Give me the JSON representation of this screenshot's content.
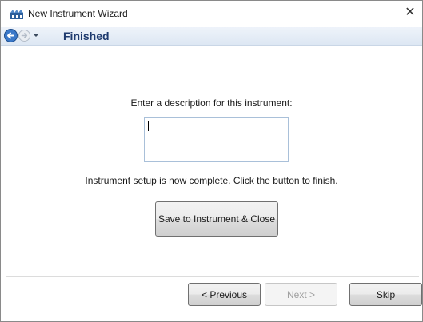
{
  "window": {
    "title": "New Instrument Wizard",
    "close_symbol": "✕"
  },
  "navigation": {
    "back_icon": "back-arrow-icon",
    "forward_icon": "forward-arrow-icon",
    "step_title": "Finished"
  },
  "content": {
    "description_label": "Enter a description for this instrument:",
    "description_value": "",
    "completion_message": "Instrument setup is now complete. Click the button to finish.",
    "save_button_label": "Save to Instrument & Close"
  },
  "footer": {
    "previous_label": "< Previous",
    "next_label": "Next >",
    "skip_label": "Skip"
  },
  "colors": {
    "step_title": "#1e3a6e",
    "nav_bar": "#e4ecf6",
    "back_button": "#3a78c9"
  }
}
